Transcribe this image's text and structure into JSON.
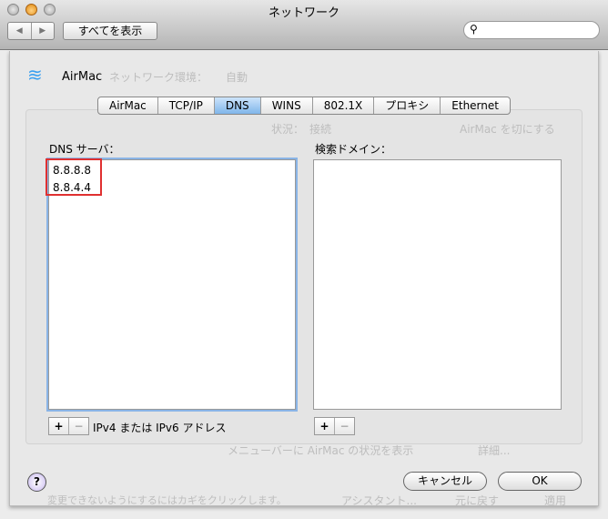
{
  "window": {
    "title": "ネットワーク",
    "show_all": "すべてを表示",
    "search_placeholder": ""
  },
  "background": {
    "location_label": "ネットワーク環境：",
    "location_value": "自動",
    "status_label": "状況：",
    "status_value": "接続",
    "airmac_off": "AirMac を切にする",
    "menubar": "メニューバーに AirMac の状況を表示",
    "advanced": "詳細...",
    "lock_text": "変更できないようにするにはカギをクリックします。",
    "assistant": "アシスタント...",
    "revert": "元に戻す",
    "apply": "適用"
  },
  "sheet": {
    "interface": "AirMac",
    "tabs": [
      "AirMac",
      "TCP/IP",
      "DNS",
      "WINS",
      "802.1X",
      "プロキシ",
      "Ethernet"
    ],
    "selected_tab": "DNS",
    "dns_label": "DNS サーバ：",
    "dns_servers": [
      "8.8.8.8",
      "8.8.4.4"
    ],
    "search_label": "検索ドメイン：",
    "dns_hint": "IPv4 または IPv6 アドレス",
    "plus": "+",
    "minus": "−",
    "help": "?",
    "cancel": "キャンセル",
    "ok": "OK"
  },
  "colors": {
    "highlight": "#e03030",
    "selected_tab": "#7fb5ea"
  }
}
